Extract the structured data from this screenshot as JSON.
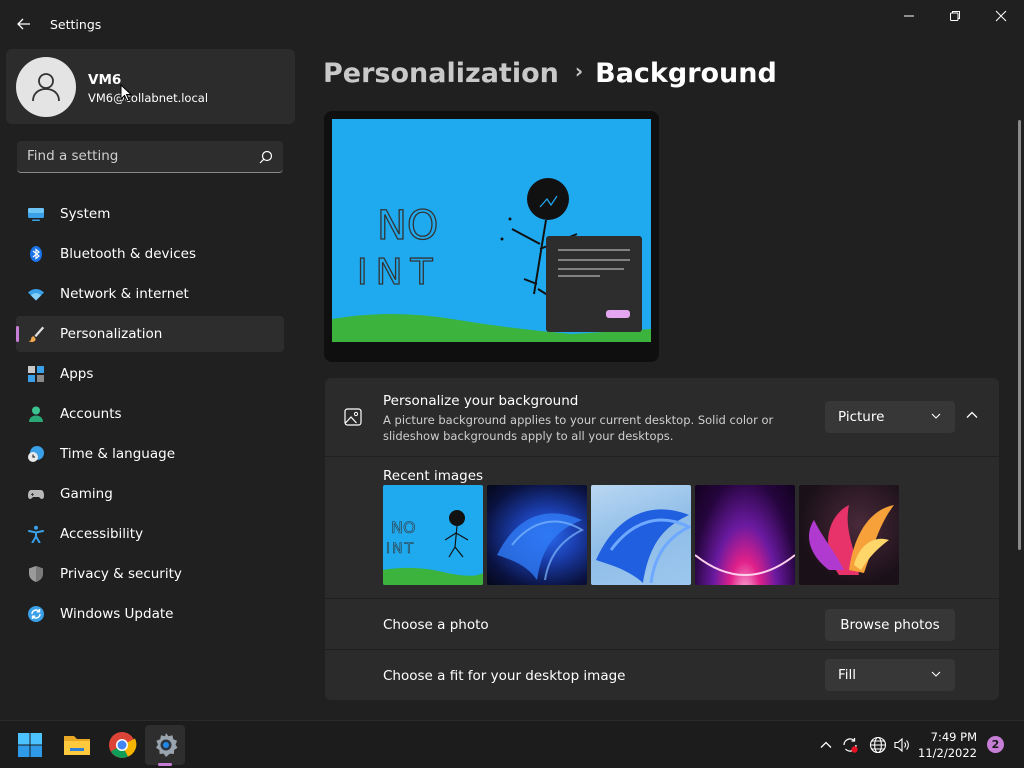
{
  "window": {
    "title": "Settings"
  },
  "profile": {
    "name": "VM6",
    "email": "VM6@collabnet.local"
  },
  "search": {
    "placeholder": "Find a setting"
  },
  "nav": {
    "items": [
      {
        "label": "System",
        "icon": "monitor-icon",
        "active": false
      },
      {
        "label": "Bluetooth & devices",
        "icon": "bluetooth-icon",
        "active": false
      },
      {
        "label": "Network & internet",
        "icon": "wifi-icon",
        "active": false
      },
      {
        "label": "Personalization",
        "icon": "brush-icon",
        "active": true
      },
      {
        "label": "Apps",
        "icon": "apps-icon",
        "active": false
      },
      {
        "label": "Accounts",
        "icon": "person-icon",
        "active": false
      },
      {
        "label": "Time & language",
        "icon": "clock-globe-icon",
        "active": false
      },
      {
        "label": "Gaming",
        "icon": "gamepad-icon",
        "active": false
      },
      {
        "label": "Accessibility",
        "icon": "accessibility-icon",
        "active": false
      },
      {
        "label": "Privacy & security",
        "icon": "shield-icon",
        "active": false
      },
      {
        "label": "Windows Update",
        "icon": "update-icon",
        "active": false
      }
    ]
  },
  "breadcrumb": {
    "parent": "Personalization",
    "separator": "›",
    "current": "Background"
  },
  "preview": {
    "handwriting_line1": "NO",
    "handwriting_line2": "INT"
  },
  "background": {
    "title": "Personalize your background",
    "description": "A picture background applies to your current desktop. Solid color or slideshow backgrounds apply to all your desktops.",
    "type_value": "Picture",
    "recent_label": "Recent images",
    "choose_photo_label": "Choose a photo",
    "browse_label": "Browse photos",
    "fit_label": "Choose a fit for your desktop image",
    "fit_value": "Fill"
  },
  "taskbar": {
    "time": "7:49 PM",
    "date": "11/2/2022",
    "notifications": "2"
  },
  "colors": {
    "accent": "#c77ed7",
    "window_bg": "#202020",
    "card_bg": "#2b2b2b",
    "sky_blue": "#1faaf0",
    "grass_green": "#3cb33c"
  }
}
